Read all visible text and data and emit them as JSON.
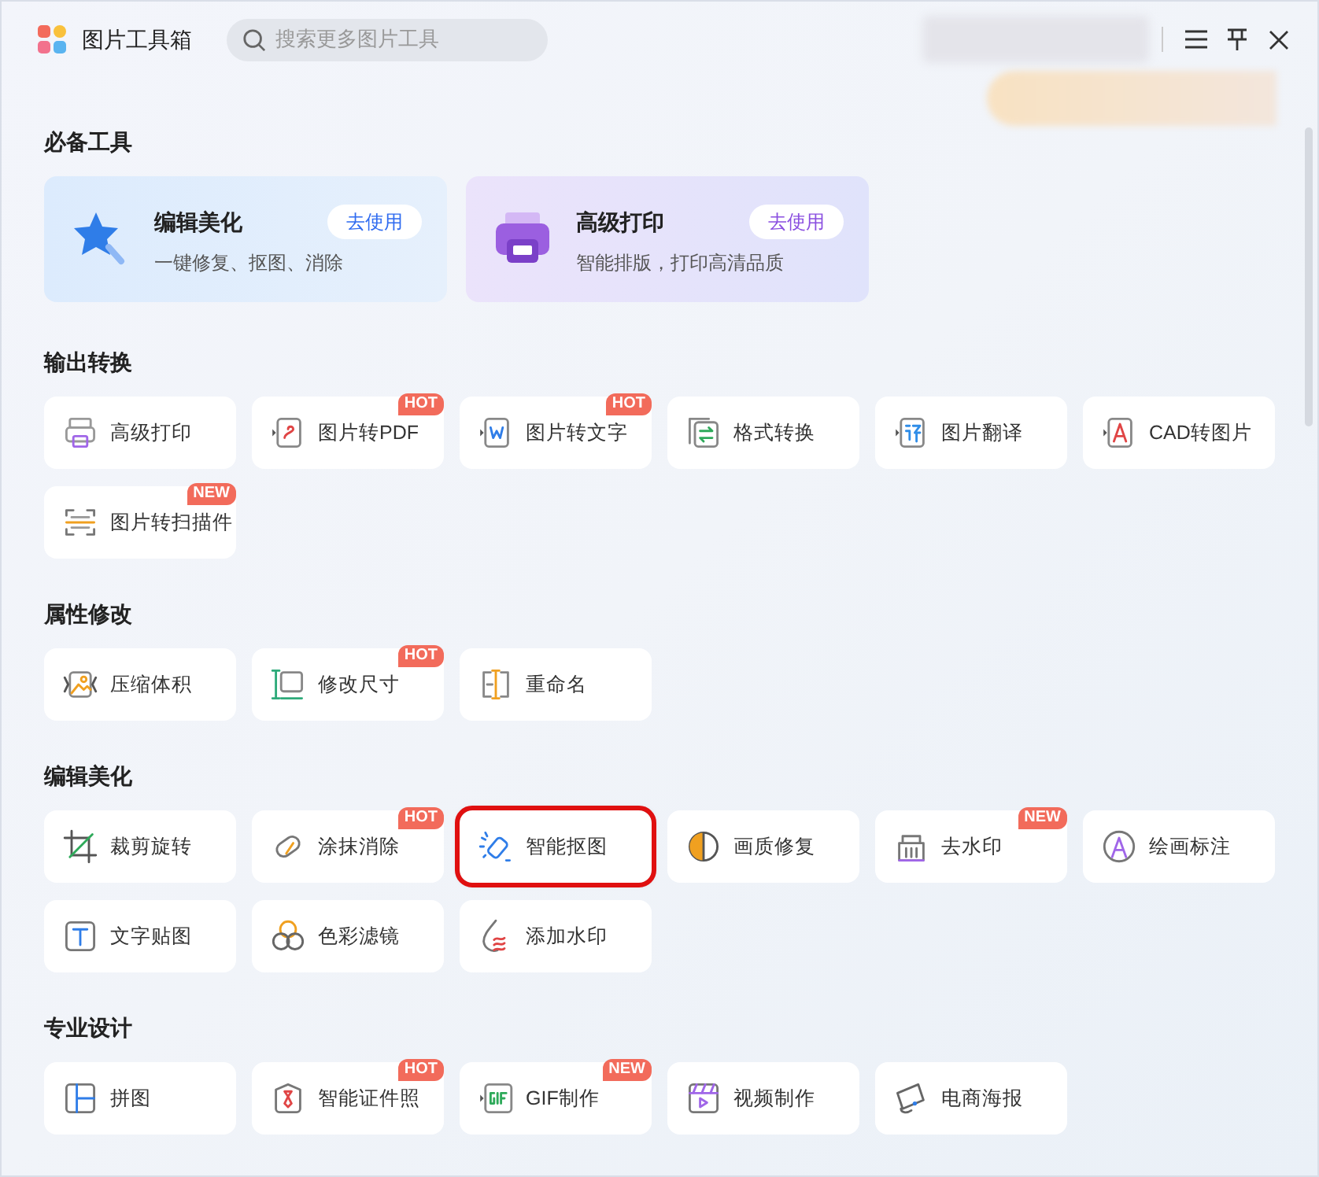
{
  "app": {
    "title": "图片工具箱"
  },
  "search": {
    "placeholder": "搜索更多图片工具"
  },
  "sections": [
    {
      "title": "必备工具",
      "kind": "featured",
      "items": [
        {
          "title": "编辑美化",
          "subtitle": "一键修复、抠图、消除",
          "action": "去使用",
          "color": "#2f6bf0"
        },
        {
          "title": "高级打印",
          "subtitle": "智能排版，打印高清品质",
          "action": "去使用",
          "color": "#8a4fe0"
        }
      ]
    },
    {
      "title": "输出转换",
      "kind": "tiles",
      "items": [
        {
          "label": "高级打印"
        },
        {
          "label": "图片转PDF",
          "badge": "HOT"
        },
        {
          "label": "图片转文字",
          "badge": "HOT"
        },
        {
          "label": "格式转换"
        },
        {
          "label": "图片翻译"
        },
        {
          "label": "CAD转图片"
        },
        {
          "label": "图片转扫描件",
          "badge": "NEW"
        }
      ]
    },
    {
      "title": "属性修改",
      "kind": "tiles",
      "items": [
        {
          "label": "压缩体积"
        },
        {
          "label": "修改尺寸",
          "badge": "HOT"
        },
        {
          "label": "重命名"
        }
      ]
    },
    {
      "title": "编辑美化",
      "kind": "tiles",
      "items": [
        {
          "label": "裁剪旋转"
        },
        {
          "label": "涂抹消除",
          "badge": "HOT"
        },
        {
          "label": "智能抠图",
          "highlighted": true
        },
        {
          "label": "画质修复"
        },
        {
          "label": "去水印",
          "badge": "NEW"
        },
        {
          "label": "绘画标注"
        },
        {
          "label": "文字贴图"
        },
        {
          "label": "色彩滤镜"
        },
        {
          "label": "添加水印"
        }
      ]
    },
    {
      "title": "专业设计",
      "kind": "tiles",
      "items": [
        {
          "label": "拼图"
        },
        {
          "label": "智能证件照",
          "badge": "HOT"
        },
        {
          "label": "GIF制作",
          "badge": "NEW"
        },
        {
          "label": "视频制作"
        },
        {
          "label": "电商海报"
        }
      ]
    }
  ]
}
